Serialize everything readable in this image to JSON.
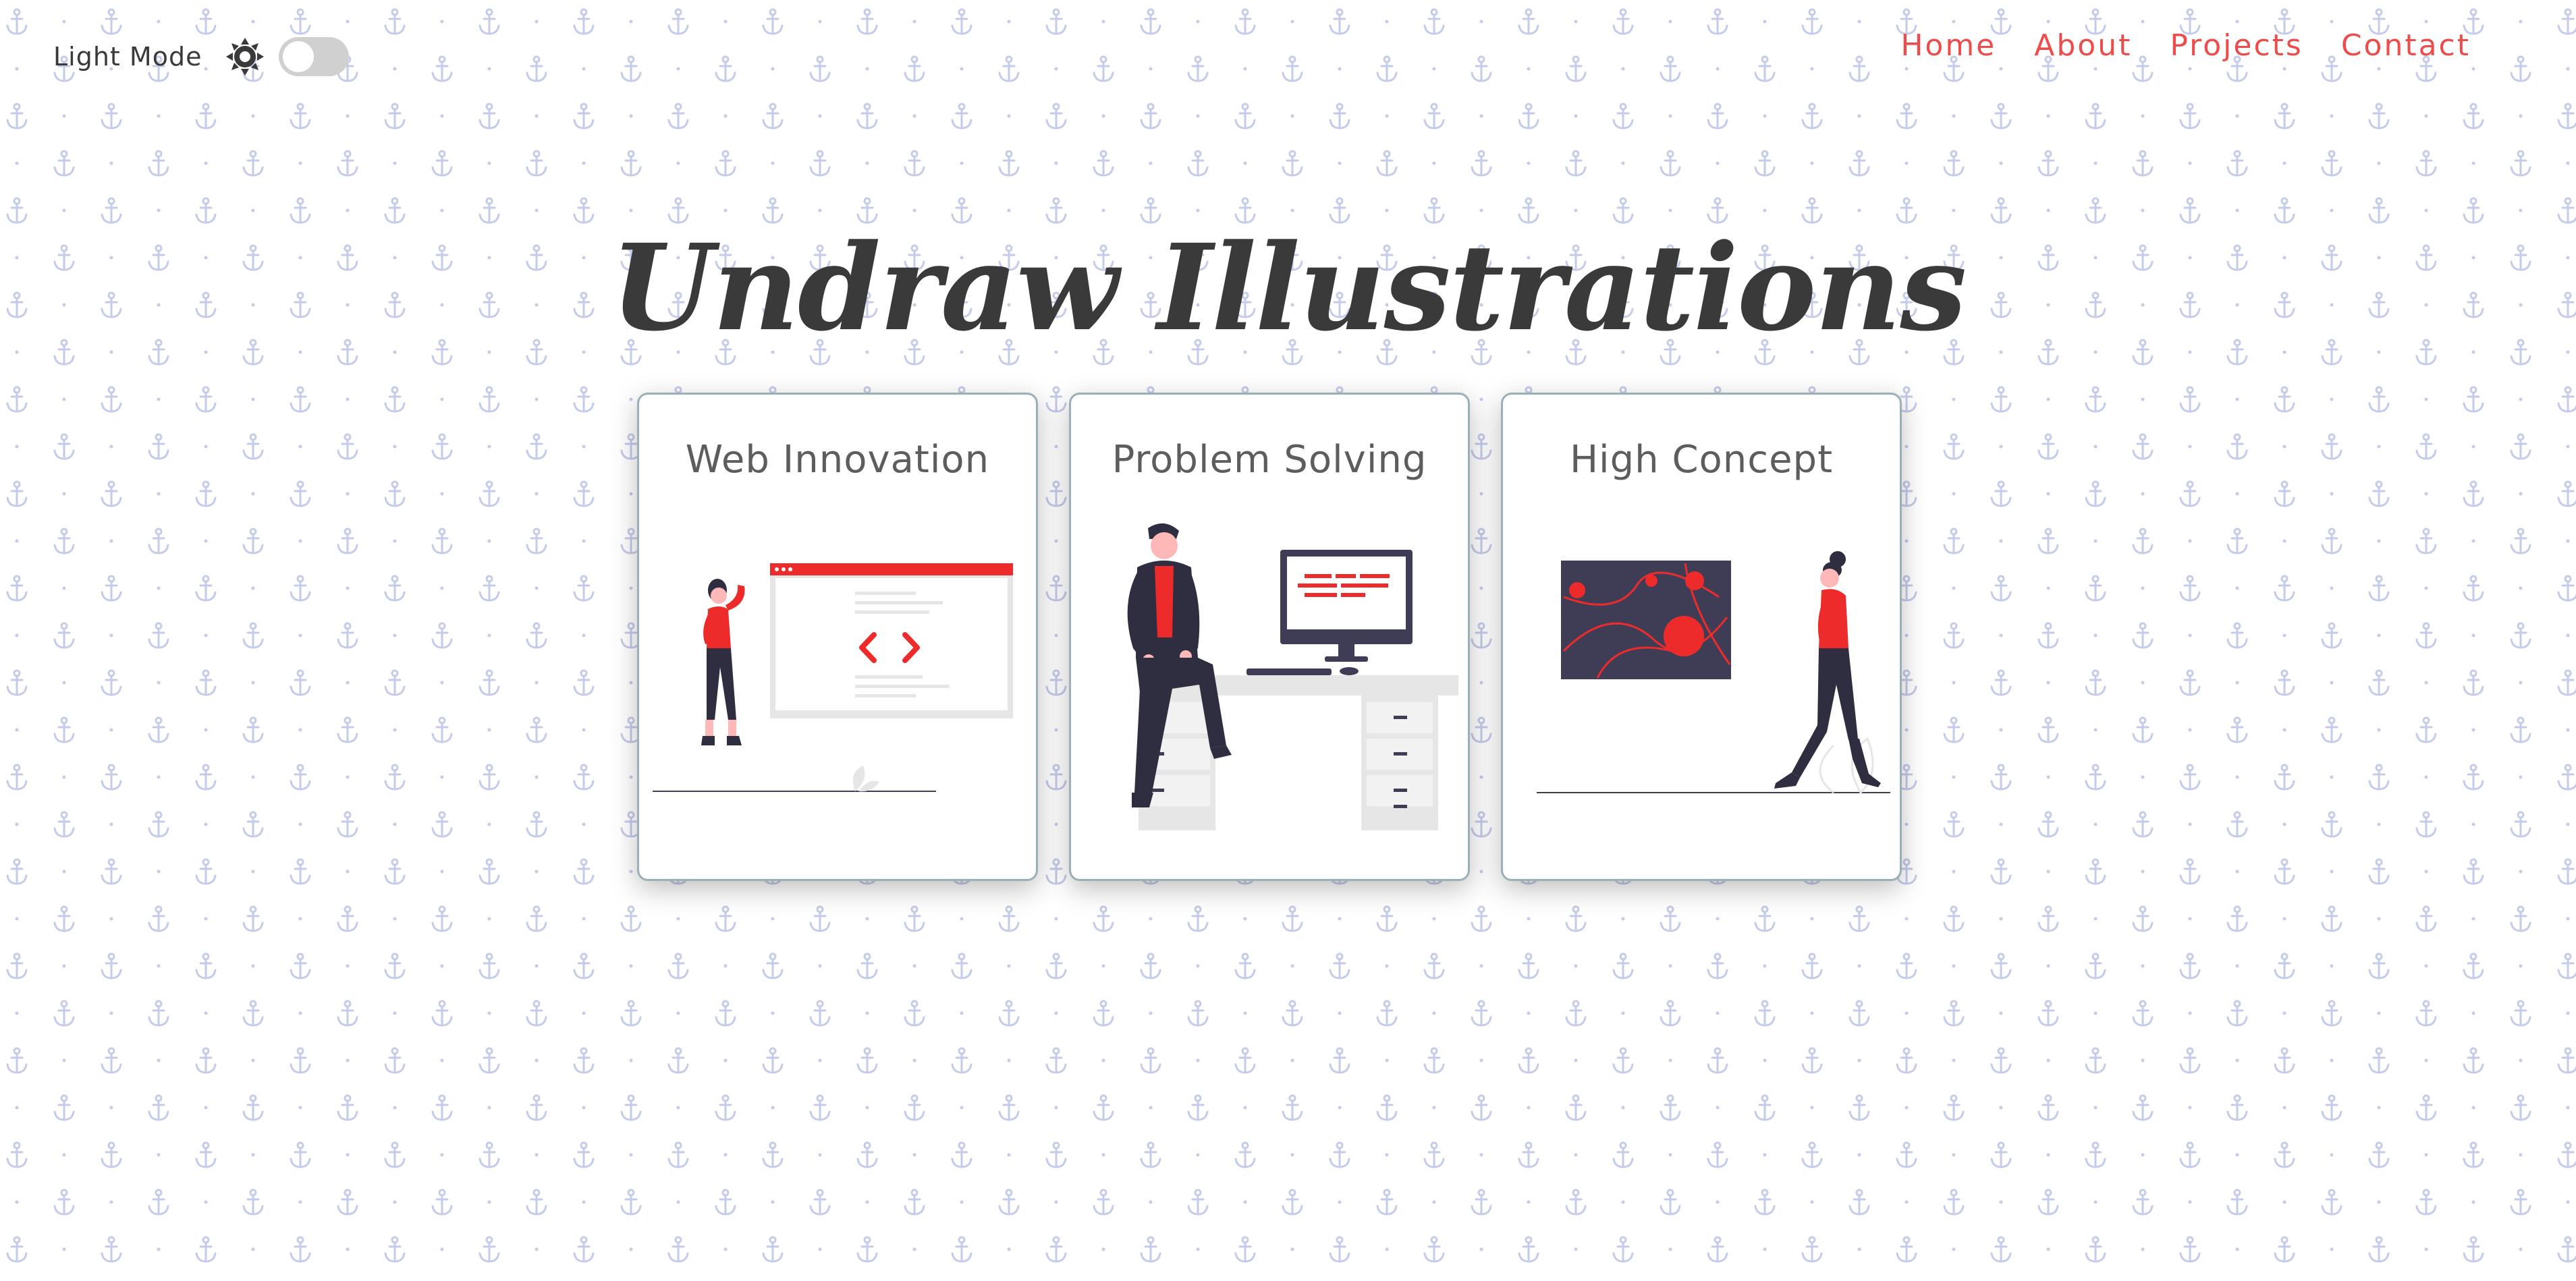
{
  "theme": {
    "mode_label": "Light Mode",
    "toggle_state": "off",
    "accent_color": "#ee4b4b",
    "text_color": "#3a3a3a",
    "pattern_color": "#c5cbea",
    "pattern_icon": "anchor-icon"
  },
  "nav": {
    "items": [
      {
        "label": "Home"
      },
      {
        "label": "About"
      },
      {
        "label": "Projects"
      },
      {
        "label": "Contact"
      }
    ]
  },
  "hero": {
    "title": "Undraw Illustrations"
  },
  "cards": [
    {
      "title": "Web Innovation",
      "illustration": "web-developer-illustration"
    },
    {
      "title": "Problem Solving",
      "illustration": "desk-programmer-illustration"
    },
    {
      "title": "High Concept",
      "illustration": "woman-walking-art-illustration"
    }
  ]
}
